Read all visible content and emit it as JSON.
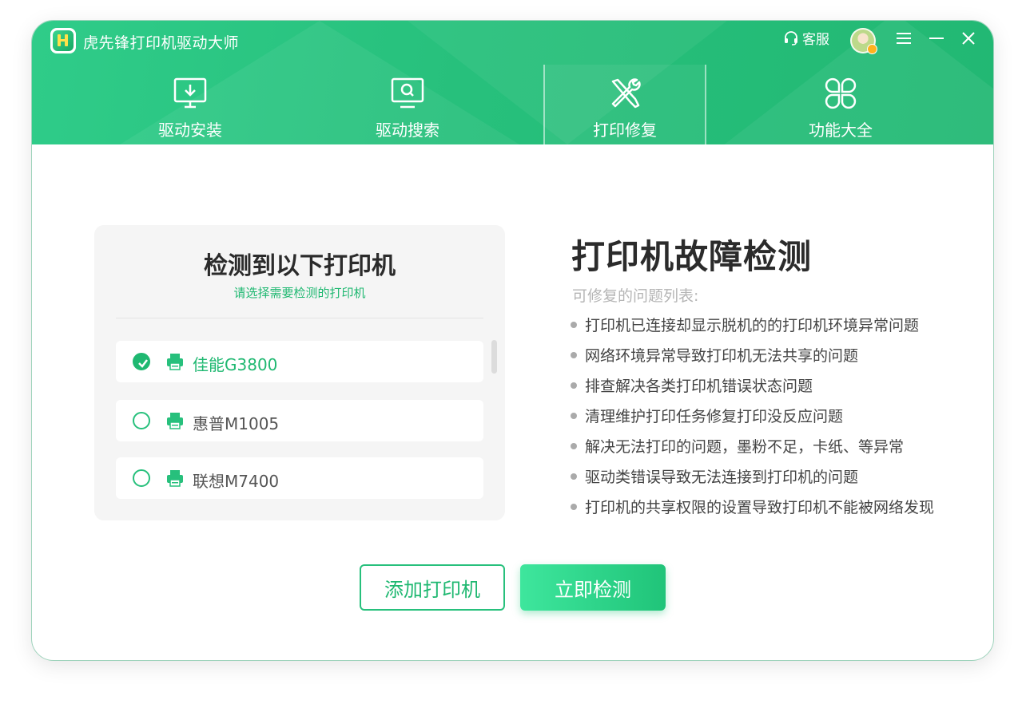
{
  "app": {
    "title": "虎先锋打印机驱动大师"
  },
  "titlebar": {
    "service_label": "客服"
  },
  "tabs": [
    {
      "label": "驱动安装",
      "icon": "monitor-download-icon"
    },
    {
      "label": "驱动搜索",
      "icon": "monitor-search-icon"
    },
    {
      "label": "打印修复",
      "icon": "wrench-screwdriver-icon",
      "active": true
    },
    {
      "label": "功能大全",
      "icon": "four-leaf-grid-icon"
    }
  ],
  "printer_panel": {
    "title": "检测到以下打印机",
    "subtitle": "请选择需要检测的打印机",
    "printers": [
      {
        "name": "佳能G3800",
        "selected": true
      },
      {
        "name": "惠普M1005",
        "selected": false
      },
      {
        "name": "联想M7400",
        "selected": false
      }
    ]
  },
  "diagnosis": {
    "title": "打印机故障检测",
    "subtitle": "可修复的问题列表:",
    "issues": [
      "打印机已连接却显示脱机的的打印机环境异常问题",
      "网络环境异常导致打印机无法共享的问题",
      "排查解决各类打印机错误状态问题",
      "清理维护打印任务修复打印没反应问题",
      "解决无法打印的问题，墨粉不足，卡纸、等异常",
      "驱动类错误导致无法连接到打印机的问题",
      "打印机的共享权限的设置导致打印机不能被网络发现"
    ]
  },
  "buttons": {
    "add_printer": "添加打印机",
    "detect_now": "立即检测"
  },
  "colors": {
    "brand_green": "#27c07c",
    "accent_green": "#1fb871"
  }
}
